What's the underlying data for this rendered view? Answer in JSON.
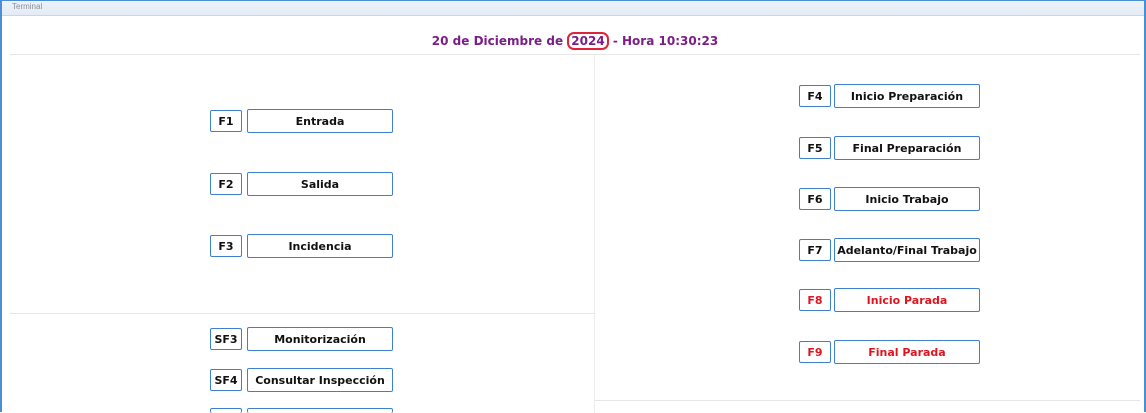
{
  "window": {
    "title": "Terminal"
  },
  "header": {
    "date_prefix": "20 de Diciembre de",
    "year": "2024",
    "time_suffix": "- Hora 10:30:23"
  },
  "left_buttons": [
    {
      "key": "F1",
      "label": "Entrada"
    },
    {
      "key": "F2",
      "label": "Salida"
    },
    {
      "key": "F3",
      "label": "Incidencia"
    }
  ],
  "left_secondary_buttons": [
    {
      "key": "SF3",
      "label": "Monitorización"
    },
    {
      "key": "SF4",
      "label": "Consultar Inspección"
    }
  ],
  "right_buttons": [
    {
      "key": "F4",
      "label": "Inicio Preparación"
    },
    {
      "key": "F5",
      "label": "Final Preparación"
    },
    {
      "key": "F6",
      "label": "Inicio Trabajo"
    },
    {
      "key": "F7",
      "label": "Adelanto/Final Trabajo"
    },
    {
      "key": "F8",
      "label": "Inicio Parada",
      "color": "#e0141f"
    },
    {
      "key": "F9",
      "label": "Final Parada",
      "color": "#e0141f"
    }
  ]
}
